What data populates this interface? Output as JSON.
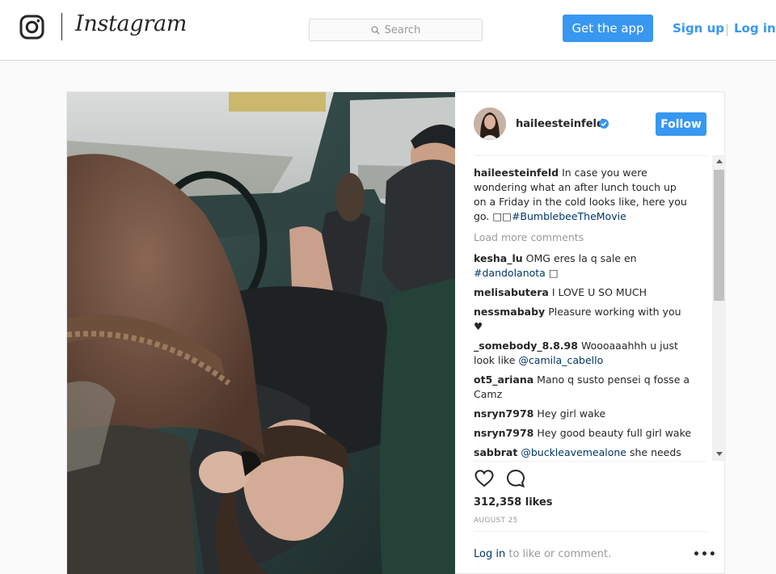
{
  "header": {
    "brand": "Instagram",
    "search_placeholder": "Search",
    "get_app_label": "Get the app",
    "signup_label": "Sign up",
    "separator": "|",
    "login_label": "Log in"
  },
  "post": {
    "username": "haileesteinfeld",
    "follow_label": "Follow",
    "caption": {
      "username": "haileesteinfeld",
      "text": "In case you were wondering what an after lunch touch up on a Friday in the cold looks like, here you go.",
      "symbols": "□□",
      "hashtag": "#BumblebeeTheMovie"
    },
    "load_more": "Load more comments",
    "comments": [
      {
        "user": "kesha_lu",
        "text": "OMG eres la q sale en",
        "link": "#dandolanota",
        "tail": " □"
      },
      {
        "user": "melisabutera",
        "text": "I LOVE U SO MUCH",
        "link": "",
        "tail": ""
      },
      {
        "user": "nessmababy",
        "text": "Pleasure working with you ♥",
        "link": "",
        "tail": ""
      },
      {
        "user": "_somebody_8.8.98",
        "text": "Woooaaahhh u just look like",
        "link": "@camila_cabello",
        "tail": ""
      },
      {
        "user": "ot5_ariana",
        "text": "Mano q susto pensei q fosse a Camz",
        "link": "",
        "tail": ""
      },
      {
        "user": "nsryn7978",
        "text": "Hey girl wake",
        "link": "",
        "tail": ""
      },
      {
        "user": "nsryn7978",
        "text": "Hey good beauty full girl wake",
        "link": "",
        "tail": ""
      },
      {
        "user": "sabbrat",
        "pre_link": "@buckleavemealone",
        "text": "she needs to get back in the studio!!"
      }
    ],
    "likes": "312,358 likes",
    "date": "AUGUST 25",
    "login_link": "Log in",
    "login_suffix": "to like or comment.",
    "more_label": "•••"
  },
  "colors": {
    "accent": "#3897f0",
    "link": "#003569",
    "muted": "#999999",
    "verified": "#3897f0"
  },
  "icons": [
    "instagram-glyph-icon",
    "search-icon",
    "verified-badge-icon",
    "heart-icon",
    "comment-icon",
    "more-options-icon"
  ]
}
